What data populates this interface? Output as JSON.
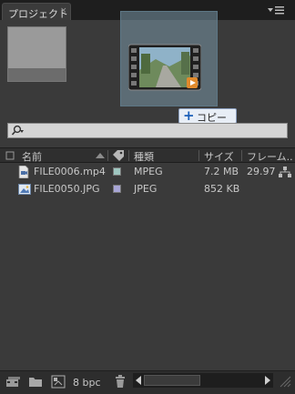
{
  "tab": {
    "label": "プロジェクト",
    "close": "×"
  },
  "copy_tooltip": {
    "plus": "+",
    "label": "コピー"
  },
  "columns": {
    "name": "名前",
    "type": "種類",
    "size": "サイズ",
    "frame": "フレーム.."
  },
  "rows": [
    {
      "name": "FILE0006.mp4",
      "type": "MPEG",
      "size": "7.2 MB",
      "frame": "29.97",
      "label_color": "#9fc7c1",
      "icon": "video-file-icon"
    },
    {
      "name": "FILE0050.JPG",
      "type": "JPEG",
      "size": "852 KB",
      "frame": "",
      "label_color": "#a8a6d6",
      "icon": "image-file-icon"
    }
  ],
  "footer": {
    "bpc": "8 bpc"
  },
  "colors": {
    "panel": "#3a3a3a",
    "tab_bar": "#1e1e1e",
    "tooltip_plus": "#1b5fb8"
  }
}
